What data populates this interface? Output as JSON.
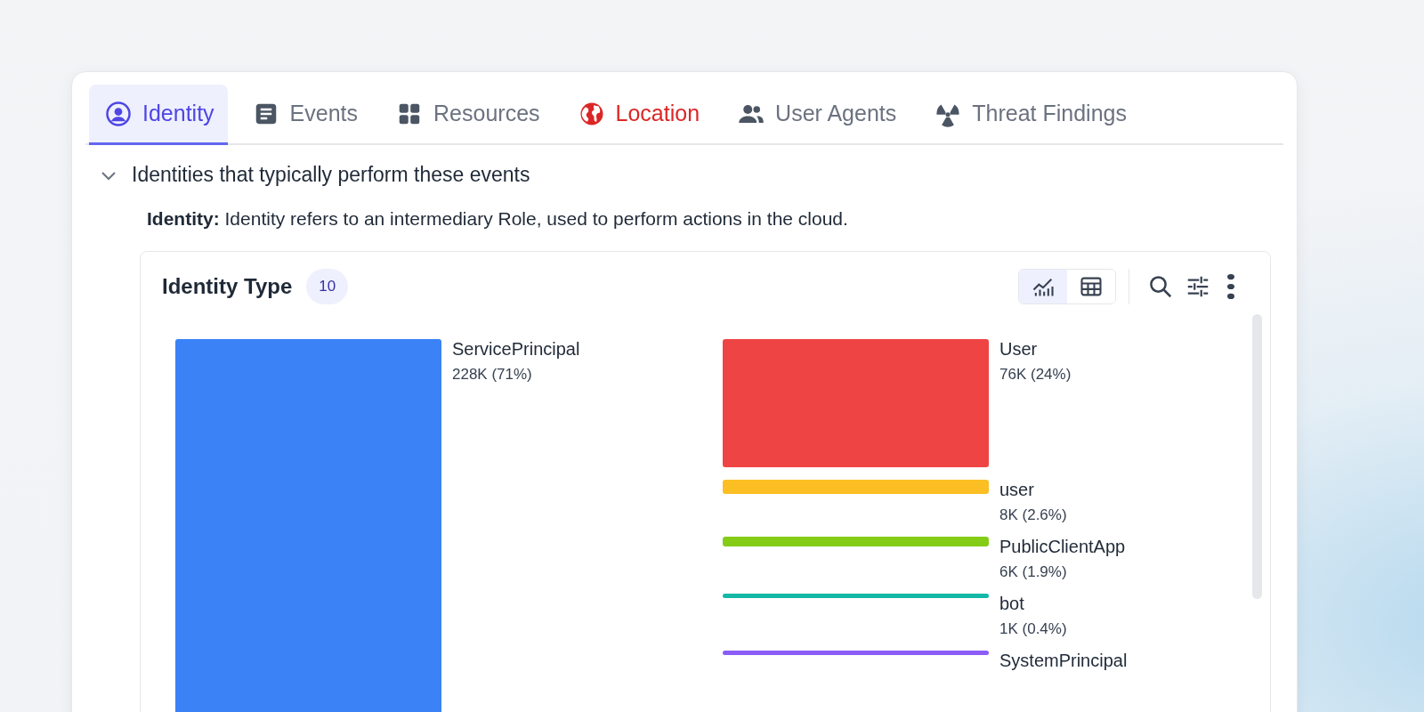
{
  "tabs": [
    {
      "label": "Identity",
      "kind": "person",
      "selected": true,
      "alert": false
    },
    {
      "label": "Events",
      "kind": "document",
      "selected": false,
      "alert": false
    },
    {
      "label": "Resources",
      "kind": "grid",
      "selected": false,
      "alert": false
    },
    {
      "label": "Location",
      "kind": "globe",
      "selected": false,
      "alert": true
    },
    {
      "label": "User Agents",
      "kind": "people",
      "selected": false,
      "alert": false
    },
    {
      "label": "Threat Findings",
      "kind": "radiation",
      "selected": false,
      "alert": false
    }
  ],
  "section": {
    "title": "Identities that typically perform these events",
    "expanded": true,
    "description": "**Identity:** Identity refers to an intermediary Role, used to perform actions in the cloud."
  },
  "card": {
    "title": "Identity Type",
    "count": "10",
    "views": [
      {
        "kind": "chart",
        "selected": true
      },
      {
        "kind": "table",
        "selected": false
      }
    ],
    "columns": [
      {
        "items": [
          {
            "name": "ServicePrincipal",
            "value": "228K (71%)",
            "color": "#3b82f6"
          }
        ]
      },
      {
        "items": [
          {
            "name": "User",
            "value": "76K (24%)",
            "color": "#ef4444"
          },
          {
            "name": "user",
            "value": "8K (2.6%)",
            "color": "#fbbf24"
          },
          {
            "name": "PublicClientApp",
            "value": "6K (1.9%)",
            "color": "#84cc16"
          },
          {
            "name": "bot",
            "value": "1K (0.4%)",
            "color": "#14b8a6"
          },
          {
            "name": "SystemPrincipal",
            "color": "#8b5cf6"
          }
        ]
      }
    ]
  }
}
